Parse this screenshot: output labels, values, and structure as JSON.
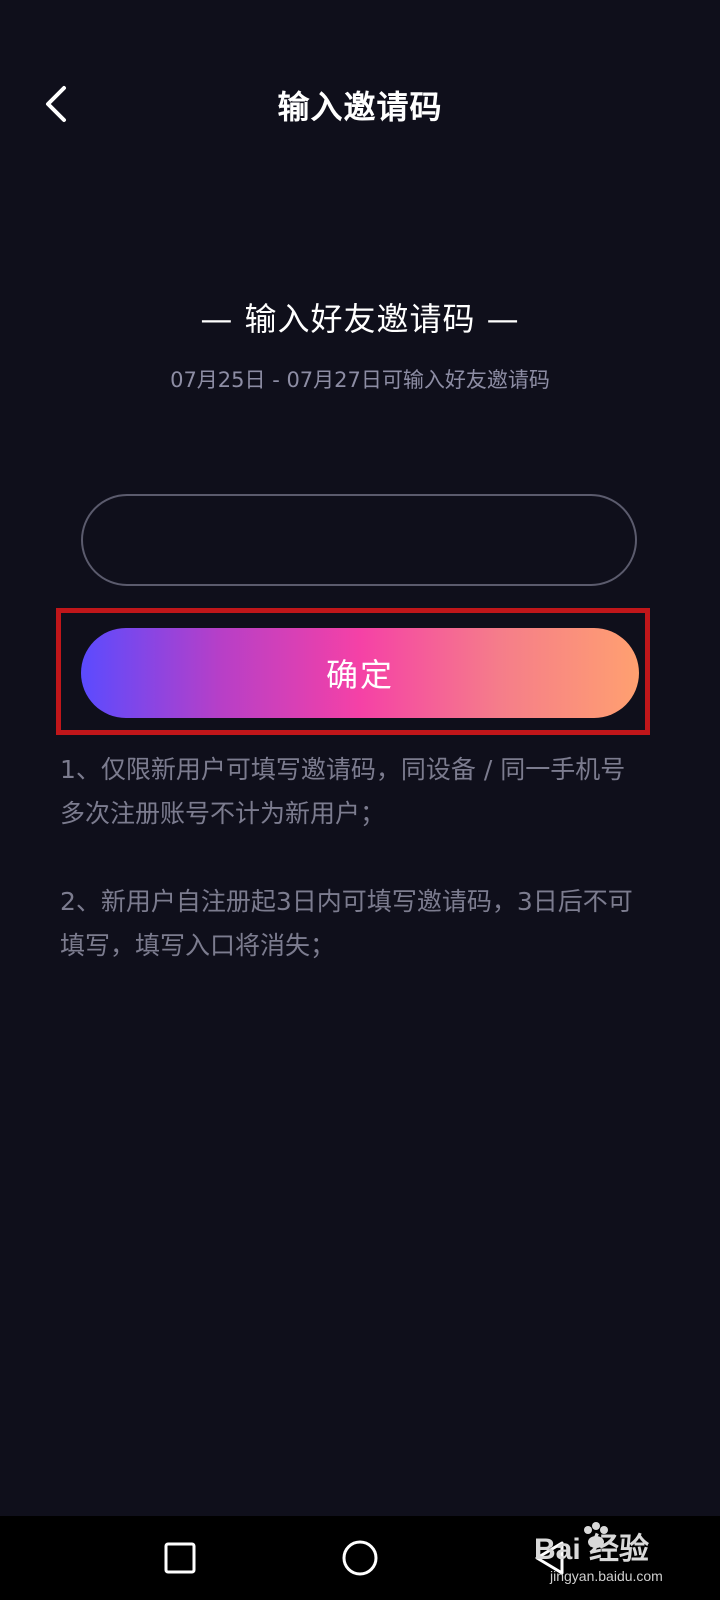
{
  "header": {
    "title": "输入邀请码",
    "back_icon": "chevron-left-icon"
  },
  "section": {
    "title": "— 输入好友邀请码 —",
    "date_range": "07月25日 - 07月27日可输入好友邀请码"
  },
  "form": {
    "code_value": "",
    "confirm_label": "确定",
    "highlight_color": "#c0161a",
    "gradient_colors": [
      "#5b4bff",
      "#f541a6",
      "#ffa070"
    ]
  },
  "rules": [
    "1、仅限新用户可填写邀请码，同设备 / 同一手机号多次注册账号不计为新用户；",
    "2、新用户自注册起3日内可填写邀请码，3日后不可填写，填写入口将消失；"
  ],
  "navbar": {
    "recent_icon": "square-icon",
    "home_icon": "circle-icon",
    "back_icon": "triangle-back-icon"
  },
  "watermark": {
    "text": "Bai 经验",
    "url": "jingyan.baidu.com"
  }
}
